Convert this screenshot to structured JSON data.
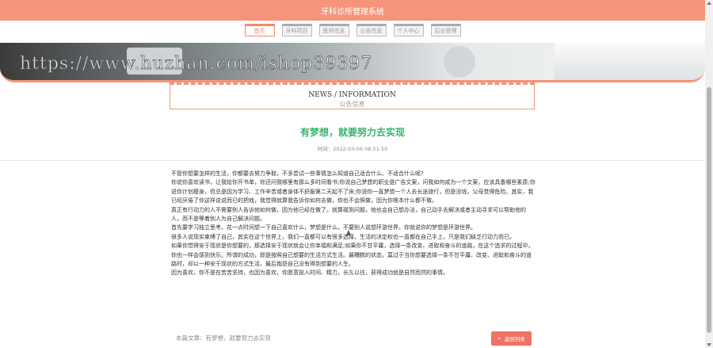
{
  "header": {
    "title": "牙科诊所管理系统"
  },
  "nav": {
    "tabs": [
      {
        "label": "首页",
        "active": true
      },
      {
        "label": "牙科项目",
        "active": false
      },
      {
        "label": "医师信息",
        "active": false
      },
      {
        "label": "公告信息",
        "active": false
      },
      {
        "label": "个人中心",
        "active": false
      },
      {
        "label": "后台管理",
        "active": false
      }
    ]
  },
  "watermark": "https://www.huzhan.com/ishop39397",
  "section": {
    "title_en": "NEWS / INFORMATION",
    "title_cn": "公告信息"
  },
  "article": {
    "title": "有梦想，就要努力去实现",
    "time": "时间：2022-03-06 08:51:55",
    "paragraphs": [
      "不管你想要怎样的生活，你都要去努力争取，不多尝试一些事情怎么知道自己适合什么、不适合什么呢?",
      "你说你喜欢读书，让我给你开书单，你还问我哪里有那么多时间看书;你说自己梦想的职业是广告文案，问我如何成为一个文案，应该具备哪些素质;你说你计划瘦身，但总是因为学习、工作辛苦或者身体不舒服第二天起不了床;你说你一直梦想一个人去长途旅行，但是没钱，父母觉得危险。其实，我已经厌倦了你这样说说而已的把戏，我觉得就算我告诉你如何去做，你也不会照做，因为你根本什么都不做。",
      "真正有行动力的人不需要别人告诉他如何做，因为他已经在做了。就算碰到问题，他也会自己想办法，自己动手去解决或者主动寻求可以帮助他的人，而不是等着别人为自己解决问题。",
      "首先要学习独立思考。花一点时间想一下自己喜欢什么，梦想是什么，不要别人说想环游世界，你就说你的梦想是环游世界。",
      "很多人说现实束缚了自己，其实在这个世界上，我们一直都可以有很多选择，生活的决定权也一直都在自己手上，只是我们缺乏行动力而已。",
      "如果你觉得安于现状是你想要的，那选择安于现状就会让你幸福和满足;如果你不甘平庸，选择一条改变、进取和奋斗的道路，在这个追求的过程中，你也一样会感到快乐。所谓的成功，即是按照自己想要的生活方式生活。最糟糕的状态，莫过于当你想要选择一条不甘平庸、改变、进取和奋斗的道路时，却以一种安于现状的方式生活，最后抱怨自己没有得到想要的人生。",
      "因为喜欢，你不是在苦苦坚持，也因为喜欢，你愿意投入时间、精力，长久以往，获得成功就是自然而然的事情。"
    ]
  },
  "footer": {
    "current_label": "本篇文章：有梦想，就要努力去实现",
    "back_button": "返回列表",
    "back_icon": "arrow-left-icon"
  },
  "colors": {
    "accent": "#f4957a",
    "title_green": "#3cb371",
    "button_red": "#f07262"
  }
}
